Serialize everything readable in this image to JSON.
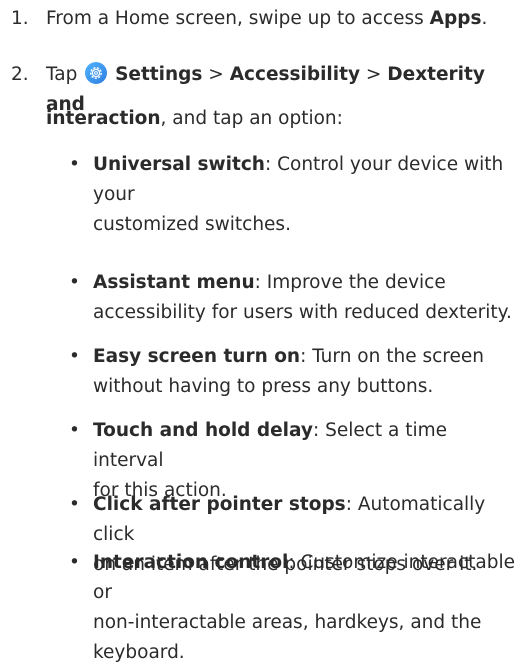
{
  "steps": [
    {
      "number": "1.",
      "text_before": "From a Home screen, swipe up to access ",
      "bold": "Apps",
      "text_after": "."
    },
    {
      "number": "2.",
      "tap": "Tap ",
      "settings_icon": "settings-gear-icon",
      "settings": "Settings",
      "sep1": " > ",
      "accessibility": "Accessibility",
      "sep2": " > ",
      "dexterity_line1": "Dexterity and",
      "dexterity_line2": "interaction",
      "text_after": ", and tap an option:"
    }
  ],
  "options": [
    {
      "title": "Universal switch",
      "desc_line1": ": Control your device with your",
      "desc_line2": "customized switches."
    },
    {
      "title": "Assistant menu",
      "desc_line1": ": Improve the device",
      "desc_line2": "accessibility for users with reduced dexterity."
    },
    {
      "title": "Easy screen turn on",
      "desc_line1": ": Turn on the screen",
      "desc_line2": "without having to press any buttons."
    },
    {
      "title": "Touch and hold delay",
      "desc_line1": ": Select a time interval",
      "desc_line2": "for this action."
    },
    {
      "title": "Click after pointer stops",
      "desc_line1": ": Automatically click",
      "desc_line2": "on an item after the pointer stops over it."
    },
    {
      "title": "Interaction control",
      "desc_line1": ": Customize interactable or",
      "desc_line2": "non-interactable areas, hardkeys, and the",
      "desc_line3": "keyboard."
    }
  ],
  "bullet_char": "•",
  "colors": {
    "text": "#2b2b2b",
    "icon_blue": "#2f7de1"
  }
}
